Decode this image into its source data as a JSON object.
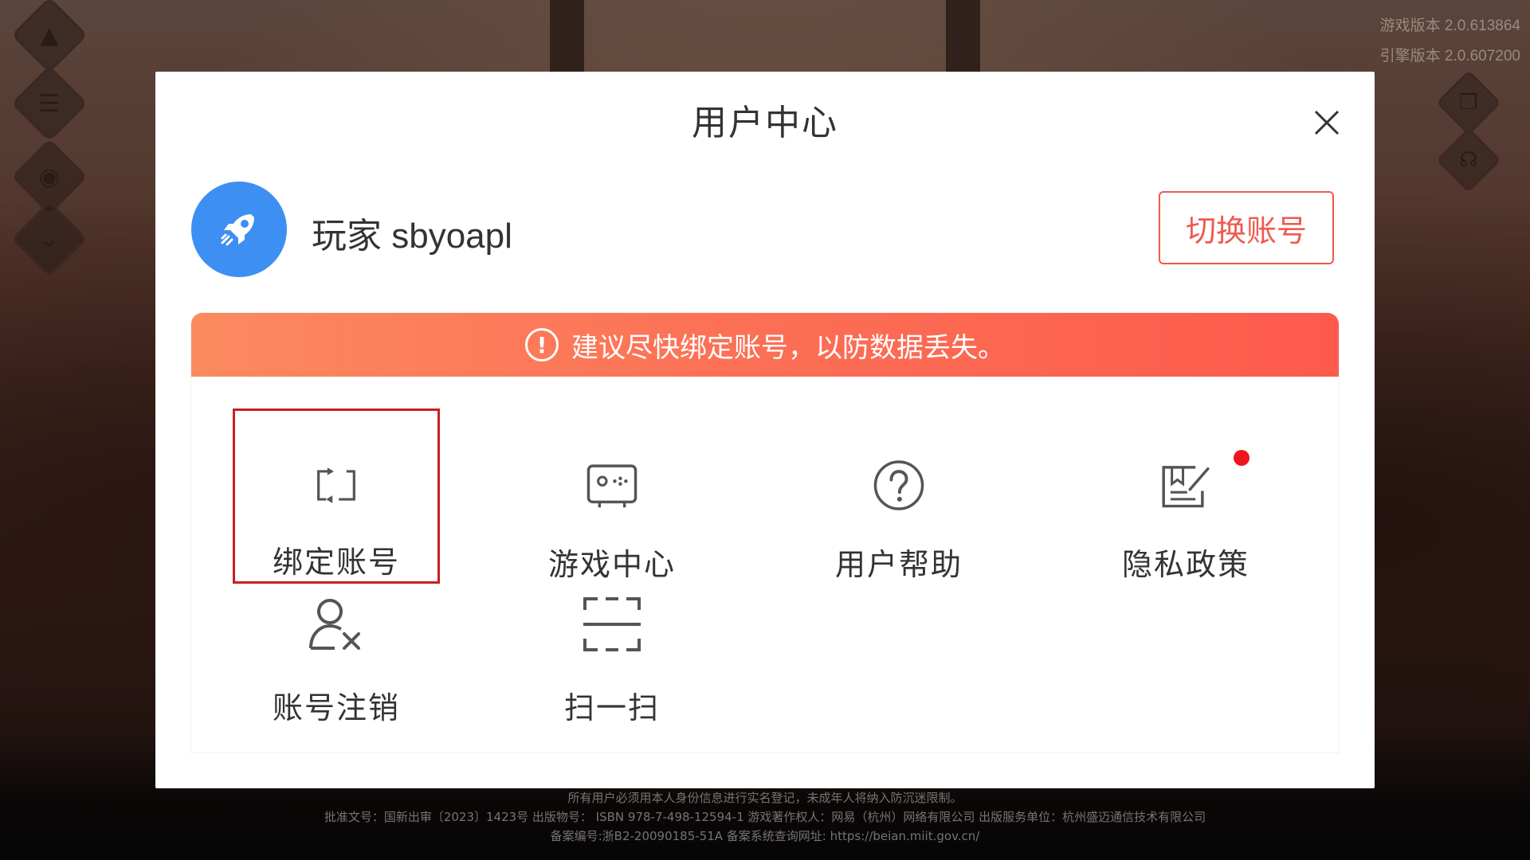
{
  "version": {
    "game": "游戏版本 2.0.613864",
    "engine": "引擎版本 2.0.607200"
  },
  "modal": {
    "title": "用户中心",
    "username": "玩家 sbyoapl",
    "switch_label": "切换账号",
    "warning": "建议尽快绑定账号，以防数据丢失。"
  },
  "tiles": [
    {
      "label": "绑定账号",
      "icon": "bind-account-icon",
      "selected": true
    },
    {
      "label": "游戏中心",
      "icon": "gamepad-icon"
    },
    {
      "label": "用户帮助",
      "icon": "question-icon"
    },
    {
      "label": "隐私政策",
      "icon": "privacy-document-icon",
      "badge": true
    },
    {
      "label": "账号注销",
      "icon": "user-remove-icon"
    },
    {
      "label": "扫一扫",
      "icon": "scan-icon"
    }
  ],
  "footer": {
    "line1": "所有用户必须用本人身份信息进行实名登记，未成年人将纳入防沉迷限制。",
    "line2": "批准文号：国新出审〔2023〕1423号 出版物号： ISBN 978-7-498-12594-1 游戏著作权人：网易（杭州）网络有限公司 出版服务单位：杭州盛迈通信技术有限公司",
    "line3": "备案编号:浙B2-20090185-51A 备案系统查询网址: https://beian.miit.gov.cn/"
  },
  "colors": {
    "accent": "#ef5a4f",
    "avatar": "#3d8ff2",
    "selection_border": "#c8201d"
  }
}
